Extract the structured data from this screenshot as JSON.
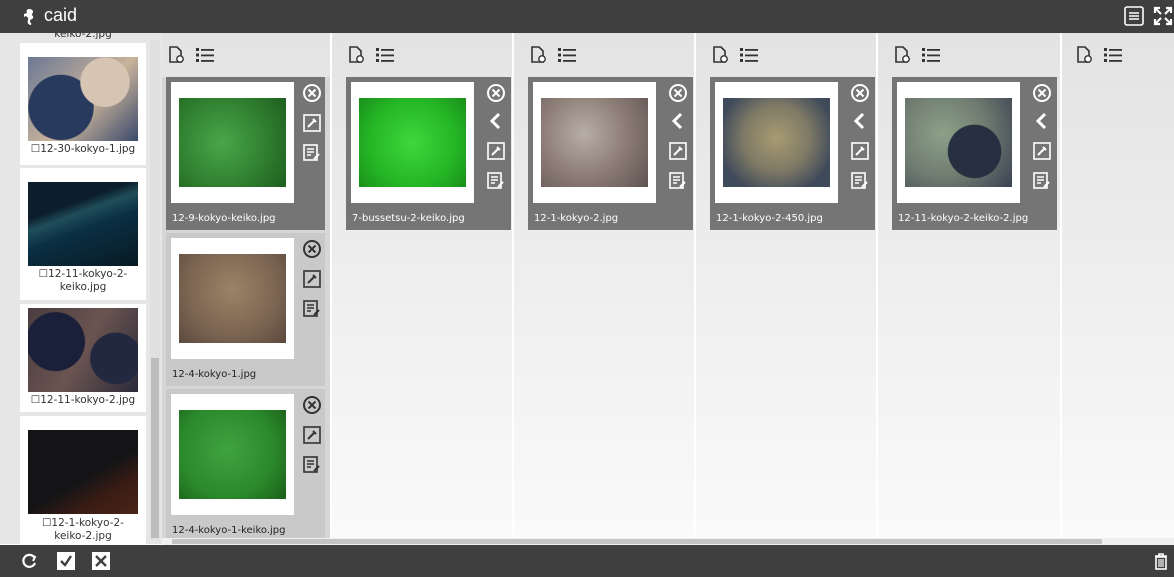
{
  "app": {
    "title": "caid",
    "logo_icon": "seahorse-icon"
  },
  "header": {
    "icons": [
      "settings-list-icon",
      "fullscreen-icon"
    ]
  },
  "sidebar": {
    "top_partial_label": "keiko-2.jpg",
    "items": [
      {
        "label": "☐12-30-kokyo-1.jpg"
      },
      {
        "label_line1": "☐12-11-kokyo-2-",
        "label_line2": "keiko.jpg"
      },
      {
        "label": "☐12-11-kokyo-2.jpg"
      },
      {
        "label_line1": "☐12-1-kokyo-2-",
        "label_line2": "keiko-2.jpg"
      }
    ]
  },
  "columns": [
    {
      "cards": [
        {
          "name": "12-9-kokyo-keiko.jpg"
        },
        {
          "name": "12-4-kokyo-1.jpg"
        },
        {
          "name": "12-4-kokyo-1-keiko.jpg"
        }
      ]
    },
    {
      "cards": [
        {
          "name": "7-bussetsu-2-keiko.jpg"
        }
      ]
    },
    {
      "cards": [
        {
          "name": "12-1-kokyo-2.jpg"
        }
      ]
    },
    {
      "cards": [
        {
          "name": "12-1-kokyo-2-450.jpg"
        }
      ]
    },
    {
      "cards": [
        {
          "name": "12-11-kokyo-2-keiko-2.jpg"
        }
      ]
    },
    {
      "cards": []
    }
  ],
  "footer": {
    "icons": [
      "refresh-icon",
      "check-all-icon",
      "uncheck-all-icon",
      "trash-icon"
    ]
  },
  "colors": {
    "bar": "#3f3f3f",
    "card": "#757575",
    "selected_card": "#d6d6d6"
  }
}
